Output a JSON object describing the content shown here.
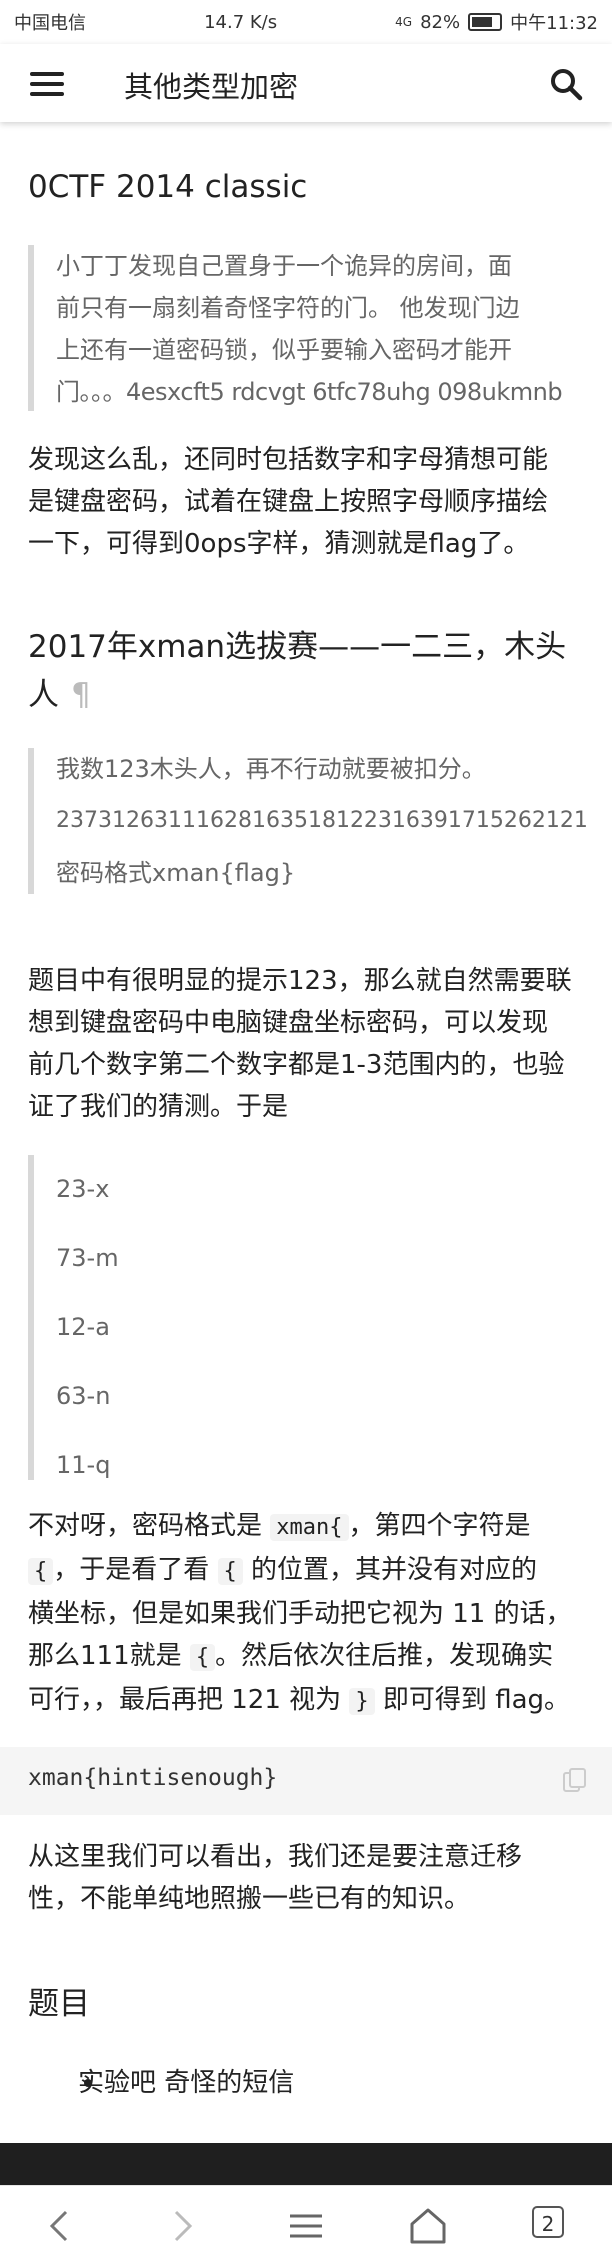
{
  "status": {
    "carrier": "中国电信",
    "speed": "14.7 K/s",
    "signal": "4G",
    "battery": "82%",
    "time": "中午11:32"
  },
  "appbar": {
    "title": "其他类型加密",
    "menu_icon": "hamburger-menu-icon",
    "search_icon": "search-icon"
  },
  "section1": {
    "heading": "0CTF 2014 classic",
    "quote_lines": [
      "小丁丁发现自己置身于一个诡异的房间，面",
      "前只有一扇刻着奇怪字符的门。 他发现门边",
      "上还有一道密码锁，似乎要输入密码才能开",
      "门。。。4esxcft5 rdcvgt 6tfc78uhg 098ukmnb"
    ],
    "para_lines": [
      "发现这么乱，还同时包括数字和字母猜想可能",
      "是键盘密码，试着在键盘上按照字母顺序描绘",
      "一下，可得到0ops字样，猜测就是flag了。"
    ]
  },
  "section2": {
    "heading_line1": "2017年xman选拔赛——一二三，木头",
    "heading_line2": "人",
    "pilcrow": "¶",
    "quote_lines": [
      "我数123木头人，再不行动就要被扣分。",
      "23731263111628163518122316391715262121",
      "密码格式xman{flag}"
    ],
    "para_lines": [
      "题目中有很明显的提示123，那么就自然需要联",
      "想到键盘密码中电脑键盘坐标密码，可以发现",
      "前几个数字第二个数字都是1-3范围内的，也验",
      "证了我们的猜测。于是"
    ],
    "list_quote": [
      "23-x",
      "73-m",
      "12-a",
      "63-n",
      "11-q"
    ],
    "para2": {
      "l1a": "不对呀，密码格式是 ",
      "l1code": "xman{",
      "l1b": "，第四个字符是",
      "l2code": "{",
      "l2b": "，于是看了看 ",
      "l2code2": "{",
      "l2c": " 的位置，其并没有对应的",
      "l3": "横坐标，但是如果我们手动把它视为 11 的话，",
      "l4a": "那么111就是 ",
      "l4code": "{",
      "l4b": "。然后依次往后推，发现确实",
      "l5a": "可行，，最后再把 121 视为 ",
      "l5code": "}",
      "l5b": " 即可得到 flag。"
    },
    "code_block": "xman{hintisenough}",
    "para3_lines": [
      "从这里我们可以看出，我们还是要注意迁移",
      "性，不能单纯地照搬一些已有的知识。"
    ]
  },
  "section3": {
    "heading": "题目",
    "items": [
      "实验吧 奇怪的短信"
    ]
  },
  "navbar": {
    "back_icon": "back-icon",
    "forward_icon": "forward-icon",
    "menu_icon": "menu-icon",
    "home_icon": "home-icon",
    "tab_count": "2"
  }
}
